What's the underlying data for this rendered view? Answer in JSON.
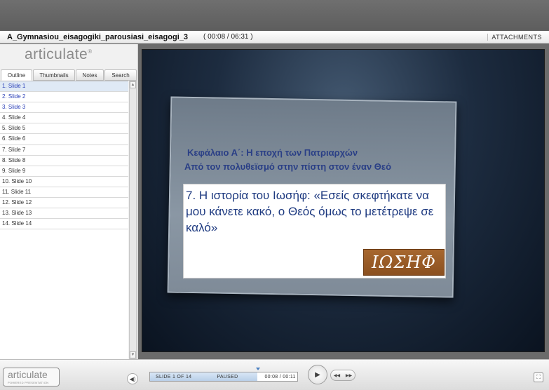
{
  "player": {
    "course_title": "A_Gymnasiou_eisagogiki_parousiasi_eisagogi_3",
    "time_display": "( 00:08 / 06:31 )",
    "attachments_label": "ATTACHMENTS"
  },
  "sidebar": {
    "logo_text": "articulate",
    "logo_mark": "®",
    "tabs": [
      "Outline",
      "Thumbnails",
      "Notes",
      "Search"
    ],
    "outline": [
      "1. Slide 1",
      "2. Slide 2",
      "3. Slide 3",
      "4. Slide 4",
      "5. Slide 5",
      "6. Slide 6",
      "7. Slide 7",
      "8. Slide 8",
      "9. Slide 9",
      "10. Slide 10",
      "11. Slide 11",
      "12. Slide 12",
      "13. Slide 13",
      "14. Slide 14"
    ],
    "visited_count": 3,
    "current_index": 0
  },
  "slide": {
    "heading_1": "Κεφάλαιο Α΄: Η εποχή των Πατριαρχών",
    "heading_2": "Από τον πολυθεϊσμό στην πίστη στον έναν Θεό",
    "body": "7. Η ιστορία του Ιωσήφ: «Εσείς σκεφτήκατε να μου κάνετε κακό, ο Θεός όμως το μετέτρεψε σε καλό»",
    "logo_text": "ΙΩΣΗΦ"
  },
  "controls": {
    "powered_logo": "articulate",
    "powered_text": "POWERED PRESENTATION",
    "slide_counter": "SLIDE 1 OF 14",
    "status": "PAUSED",
    "time": "00:08 / 00:11",
    "progress_fraction": 0.73,
    "play_icon": "play-icon",
    "prev_icon": "prev-icon",
    "next_icon": "next-icon"
  }
}
